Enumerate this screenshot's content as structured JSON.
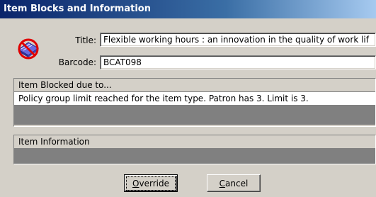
{
  "window": {
    "title": "Item Blocks and Information"
  },
  "form": {
    "title_label": "Title:",
    "title_value": "Flexible working hours : an innovation in the quality of work lif",
    "barcode_label": "Barcode:",
    "barcode_value": "BCAT098"
  },
  "blocked_panel": {
    "header": "Item Blocked due to...",
    "rows": [
      "Policy group limit reached for the item type.  Patron has 3.  Limit is 3."
    ]
  },
  "info_panel": {
    "header": "Item Information"
  },
  "buttons": {
    "override_mnemonic": "O",
    "override_rest": "verride",
    "cancel_mnemonic": "C",
    "cancel_rest": "ancel"
  },
  "icons": {
    "window_icon": "blocked-book-icon"
  }
}
